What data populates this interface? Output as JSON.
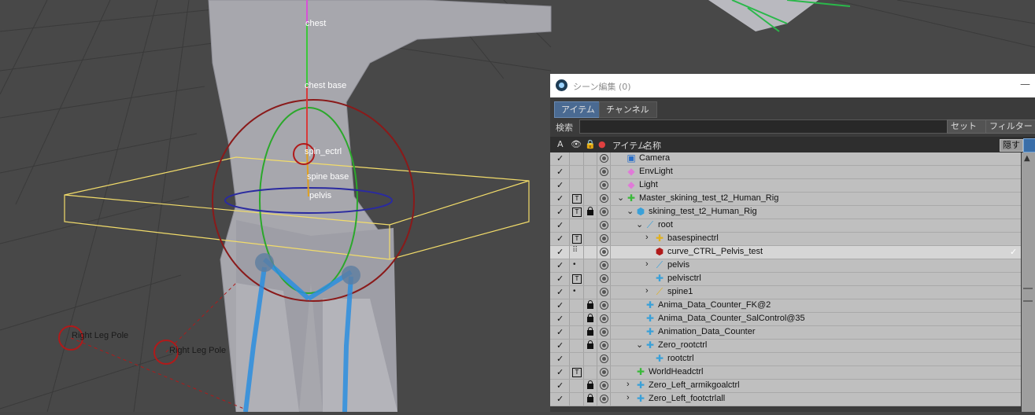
{
  "viewport": {
    "labels": {
      "chest": "chest",
      "chest_base": "chest base",
      "spin_ectrl": "spin_ectrl",
      "spine_base": "spine base",
      "pelvis": "pelvis",
      "right_leg_pole_1": "Right Leg Pole",
      "right_leg_pole_2": "Right Leg Pole"
    }
  },
  "panel": {
    "title": "シーン編集 (0)",
    "minimize": "—",
    "tabs": [
      "アイテム",
      "チャンネル"
    ],
    "search_label": "検索",
    "search_value": "",
    "set_dropdown": "セット ▾",
    "filter_dropdown": "フィルター ▾",
    "columns": {
      "a": "A",
      "item": "アイテム",
      "name": "名称",
      "hide": "隠す"
    },
    "rows": [
      {
        "name": "Camera",
        "icon": "camera-icon",
        "glyph": "▣",
        "color": "#2a6fc9",
        "indent": 0,
        "arrow": "",
        "lock": false,
        "eye": "",
        "T": false
      },
      {
        "name": "EnvLight",
        "icon": "env-light-icon",
        "glyph": "◆",
        "color": "#e07ad8",
        "indent": 0,
        "arrow": "",
        "lock": false,
        "eye": "",
        "T": false
      },
      {
        "name": "Light",
        "icon": "light-icon",
        "glyph": "◆",
        "color": "#e07ad8",
        "indent": 0,
        "arrow": "",
        "lock": false,
        "eye": "",
        "T": false
      },
      {
        "name": "Master_skining_test_t2_Human_Rig",
        "icon": "locator-icon",
        "glyph": "✚",
        "color": "#3ab83a",
        "indent": 0,
        "arrow": "⌄",
        "lock": false,
        "eye": "",
        "T": true
      },
      {
        "name": "skining_test_t2_Human_Rig",
        "icon": "mesh-icon",
        "glyph": "⬢",
        "color": "#3aa0d8",
        "indent": 1,
        "arrow": "⌄",
        "lock": true,
        "eye": "",
        "T": true
      },
      {
        "name": "root",
        "icon": "bone-icon",
        "glyph": "⟋",
        "color": "#3aa0d8",
        "indent": 2,
        "arrow": "⌄",
        "lock": false,
        "eye": "",
        "T": false
      },
      {
        "name": "basespinectrl",
        "icon": "locator-icon",
        "glyph": "✚",
        "color": "#e0b020",
        "indent": 3,
        "arrow": "›",
        "lock": false,
        "eye": "",
        "T": true
      },
      {
        "name": "curve_CTRL_Pelvis_test",
        "icon": "curve-icon",
        "glyph": "⬢",
        "color": "#b01a1a",
        "indent": 3,
        "arrow": "",
        "lock": false,
        "eye": "",
        "T": false,
        "selected": true
      },
      {
        "name": "pelvis",
        "icon": "bone-icon",
        "glyph": "⟋",
        "color": "#3aa0d8",
        "indent": 3,
        "arrow": "›",
        "lock": false,
        "eye": "•",
        "T": false
      },
      {
        "name": "pelvisctrl",
        "icon": "locator-icon",
        "glyph": "✚",
        "color": "#3aa0d8",
        "indent": 3,
        "arrow": "",
        "lock": false,
        "eye": "",
        "T": true
      },
      {
        "name": "spine1",
        "icon": "bone-icon",
        "glyph": "⟋",
        "color": "#e0b020",
        "indent": 3,
        "arrow": "›",
        "lock": false,
        "eye": "•",
        "T": false
      },
      {
        "name": "Anima_Data_Counter_FK@2",
        "icon": "locator-icon",
        "glyph": "✚",
        "color": "#3aa0d8",
        "indent": 2,
        "arrow": "",
        "lock": true,
        "eye": "",
        "T": false
      },
      {
        "name": "Anima_Data_Counter_SalControl@35",
        "icon": "locator-icon",
        "glyph": "✚",
        "color": "#3aa0d8",
        "indent": 2,
        "arrow": "",
        "lock": true,
        "eye": "",
        "T": false
      },
      {
        "name": "Animation_Data_Counter",
        "icon": "locator-icon",
        "glyph": "✚",
        "color": "#3aa0d8",
        "indent": 2,
        "arrow": "",
        "lock": true,
        "eye": "",
        "T": false
      },
      {
        "name": "Zero_rootctrl",
        "icon": "locator-icon",
        "glyph": "✚",
        "color": "#3aa0d8",
        "indent": 2,
        "arrow": "⌄",
        "lock": true,
        "eye": "",
        "T": false
      },
      {
        "name": "rootctrl",
        "icon": "locator-icon",
        "glyph": "✚",
        "color": "#3aa0d8",
        "indent": 3,
        "arrow": "",
        "lock": false,
        "eye": "",
        "T": false
      },
      {
        "name": "WorldHeadctrl",
        "icon": "locator-icon",
        "glyph": "✚",
        "color": "#3ab83a",
        "indent": 1,
        "arrow": "",
        "lock": false,
        "eye": "",
        "T": true
      },
      {
        "name": "Zero_Left_armikgoalctrl",
        "icon": "locator-icon",
        "glyph": "✚",
        "color": "#3aa0d8",
        "indent": 1,
        "arrow": "›",
        "lock": true,
        "eye": "",
        "T": false
      },
      {
        "name": "Zero_Left_footctrlall",
        "icon": "locator-icon",
        "glyph": "✚",
        "color": "#3aa0d8",
        "indent": 1,
        "arrow": "›",
        "lock": true,
        "eye": "",
        "T": false
      }
    ]
  }
}
